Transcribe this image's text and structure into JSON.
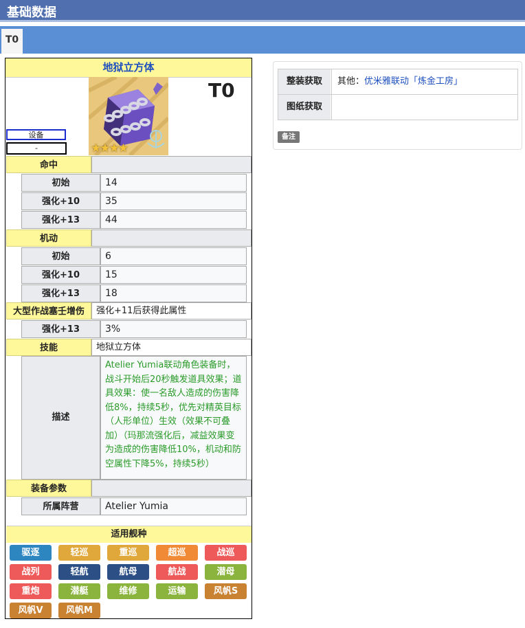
{
  "header": {
    "title": "基础数据"
  },
  "tabs": [
    {
      "label": "T0"
    }
  ],
  "equipment": {
    "name": "地狱立方体",
    "tier": "T0",
    "type": "设备",
    "faction_short": "-",
    "rarity_stars": 4
  },
  "stats": [
    {
      "name": "命中",
      "rows": [
        {
          "label": "初始",
          "value": "14"
        },
        {
          "label": "强化+10",
          "value": "35"
        },
        {
          "label": "强化+13",
          "value": "44"
        }
      ]
    },
    {
      "name": "机动",
      "rows": [
        {
          "label": "初始",
          "value": "6"
        },
        {
          "label": "强化+10",
          "value": "15"
        },
        {
          "label": "强化+13",
          "value": "18"
        }
      ]
    }
  ],
  "special": {
    "name": "大型作战塞壬增伤",
    "value": "强化+11后获得此属性",
    "rows": [
      {
        "label": "强化+13",
        "value": "3%"
      }
    ]
  },
  "skill": {
    "label": "技能",
    "value": "地狱立方体",
    "desc_label": "描述",
    "description": "Atelier Yumia联动角色装备时，战斗开始后20秒触发道具效果；道具效果：使一名敌人造成的伤害降低8%，持续5秒，优先对精英目标（人形单位）生效（效果不可叠加）（玛那流强化后，减益效果变为造成的伤害降低10%，机动和防空属性下降5%，持续5秒）"
  },
  "params": {
    "label": "装备参数",
    "rows": [
      {
        "label": "所属阵营",
        "value": "Atelier Yumia"
      }
    ]
  },
  "ship_types": {
    "title": "适用舰种",
    "items": [
      {
        "label": "驱逐",
        "color": "#2e86c1"
      },
      {
        "label": "轻巡",
        "color": "#e0a83a"
      },
      {
        "label": "重巡",
        "color": "#e0a83a"
      },
      {
        "label": "超巡",
        "color": "#f08a36"
      },
      {
        "label": "战巡",
        "color": "#ee5a5a"
      },
      {
        "label": "战列",
        "color": "#ee5a5a"
      },
      {
        "label": "轻航",
        "color": "#2c4f86"
      },
      {
        "label": "航母",
        "color": "#2c4f86"
      },
      {
        "label": "航战",
        "color": "#ee5a5a"
      },
      {
        "label": "潜母",
        "color": "#8ab43e"
      },
      {
        "label": "重炮",
        "color": "#ee5a5a"
      },
      {
        "label": "潜艇",
        "color": "#8ab43e"
      },
      {
        "label": "维修",
        "color": "#8ab43e"
      },
      {
        "label": "运输",
        "color": "#8ab43e"
      },
      {
        "label": "风帆S",
        "color": "#c98132"
      },
      {
        "label": "风帆V",
        "color": "#c98132"
      },
      {
        "label": "风帆M",
        "color": "#c98132"
      }
    ]
  },
  "acquisition": {
    "full_label": "整装获取",
    "full_prefix": "其他：",
    "full_link": "优米雅联动「炼金工房」",
    "blueprint_label": "图纸获取",
    "blueprint_value": "",
    "note_label": "备注"
  }
}
